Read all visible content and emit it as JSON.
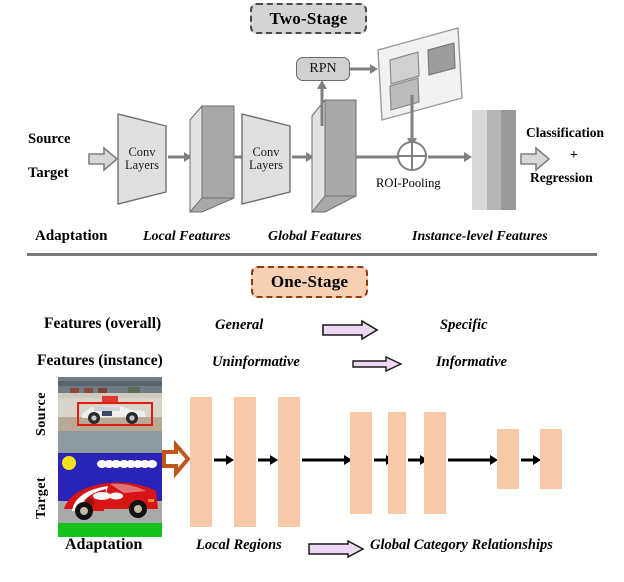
{
  "figure": {
    "title_top": "Two-Stage",
    "title_bottom": "One-Stage"
  },
  "colors": {
    "two_stage_badge_fill": "#d4d4d4",
    "two_stage_badge_border": "#4a4a4a",
    "one_stage_badge_fill": "#f7cfb2",
    "one_stage_badge_border": "#8e3b10",
    "arrow_gray": "#808080",
    "block_arrow_fill": "#d8d8d8",
    "slab_front": "#a8a8a8",
    "slab_side": "#e2e2e2",
    "conv_fill": "#e0e0e0",
    "proposal_map_fill": "#f2f2f2",
    "peach_bar": "#f7c9a8",
    "orange_arrow": "#c1561a",
    "lavender_arrow": "#eed7f2",
    "divider": "#7a7a7a"
  },
  "two_stage": {
    "inputs": [
      "Source",
      "Target"
    ],
    "conv_blocks": [
      {
        "line1": "Conv",
        "line2": "Layers"
      },
      {
        "line1": "Conv",
        "line2": "Layers"
      }
    ],
    "rpn_label": "RPN",
    "roi_label": "ROI-Pooling",
    "output_lines": [
      "Classification",
      "+",
      "Regression"
    ],
    "bottom_labels": [
      "Adaptation",
      "Local Features",
      "Global Features",
      "Instance-level Features"
    ]
  },
  "one_stage": {
    "rows": [
      {
        "name": "Features (overall)",
        "from": "General",
        "to": "Specific"
      },
      {
        "name": "Features (instance)",
        "from": "Uninformative",
        "to": "Informative"
      }
    ],
    "image_labels": [
      "Source",
      "Target"
    ],
    "bottom_labels": [
      "Adaptation",
      "Local Regions",
      "Global Category Relationships"
    ]
  },
  "icons": {
    "input_block_arrow": "block-arrow-right-icon",
    "output_block_arrow": "block-arrow-right-icon",
    "orange_block_arrow": "orange-block-arrow-right-icon",
    "lavender_block_arrow": "lavender-block-arrow-right-icon",
    "roi_sum": "circle-plus-cross-icon"
  }
}
